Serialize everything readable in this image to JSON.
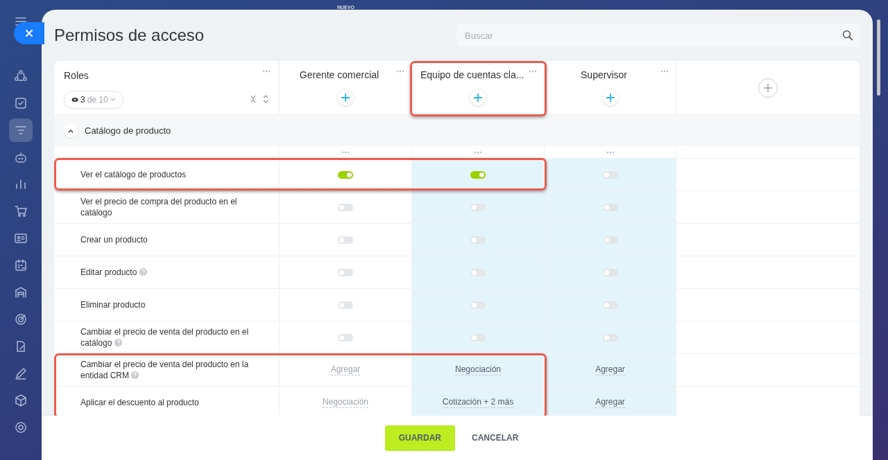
{
  "top_label": "NUEVO",
  "sidebar": {
    "items": [
      {
        "selected": false
      },
      {
        "selected": false
      },
      {
        "selected": true
      },
      {
        "selected": false
      },
      {
        "selected": false
      },
      {
        "selected": false
      },
      {
        "selected": false
      },
      {
        "selected": false
      },
      {
        "selected": false
      },
      {
        "selected": false
      },
      {
        "selected": false
      },
      {
        "selected": false
      },
      {
        "selected": false
      },
      {
        "selected": false
      }
    ]
  },
  "title": "Permisos de acceso",
  "search": {
    "placeholder": "Buscar"
  },
  "roles_header": {
    "label": "Roles",
    "visible_count": "3",
    "total": "de 10"
  },
  "columns": [
    {
      "name": "Gerente comercial",
      "highlighted": false,
      "tinted": false
    },
    {
      "name": "Equipo de cuentas cla...",
      "highlighted": true,
      "tinted": true
    },
    {
      "name": "Supervisor",
      "highlighted": false,
      "tinted": true
    }
  ],
  "section": {
    "title": "Catálogo de producto",
    "expanded": true
  },
  "rows": [
    {
      "label": "Ver el catálogo de productos",
      "help": false,
      "highlighted": true,
      "cells": [
        {
          "kind": "toggle",
          "on": true
        },
        {
          "kind": "toggle",
          "on": true
        },
        {
          "kind": "toggle",
          "on": false
        }
      ]
    },
    {
      "label": "Ver el precio de compra del producto en el catálogo",
      "help": false,
      "highlighted": false,
      "cells": [
        {
          "kind": "toggle",
          "on": false
        },
        {
          "kind": "toggle",
          "on": false
        },
        {
          "kind": "toggle",
          "on": false
        }
      ]
    },
    {
      "label": "Crear un producto",
      "help": false,
      "highlighted": false,
      "cells": [
        {
          "kind": "toggle",
          "on": false
        },
        {
          "kind": "toggle",
          "on": false
        },
        {
          "kind": "toggle",
          "on": false
        }
      ]
    },
    {
      "label": "Editar producto",
      "help": true,
      "highlighted": false,
      "cells": [
        {
          "kind": "toggle",
          "on": false
        },
        {
          "kind": "toggle",
          "on": false
        },
        {
          "kind": "toggle",
          "on": false
        }
      ]
    },
    {
      "label": "Eliminar producto",
      "help": false,
      "highlighted": false,
      "cells": [
        {
          "kind": "toggle",
          "on": false
        },
        {
          "kind": "toggle",
          "on": false
        },
        {
          "kind": "toggle",
          "on": false
        }
      ]
    },
    {
      "label": "Cambiar el precio de venta del producto en el catálogo",
      "help": true,
      "highlighted": false,
      "cells": [
        {
          "kind": "toggle",
          "on": false
        },
        {
          "kind": "toggle",
          "on": false
        },
        {
          "kind": "toggle",
          "on": false
        }
      ]
    },
    {
      "label": "Cambiar el precio de venta del producto en la entidad CRM",
      "help": true,
      "highlighted": true,
      "cells": [
        {
          "kind": "select",
          "value": "Agregar",
          "muted": true
        },
        {
          "kind": "select",
          "value": "Negociación",
          "muted": false
        },
        {
          "kind": "select",
          "value": "Agregar",
          "muted": false
        }
      ]
    },
    {
      "label": "Aplicar el descuento al producto",
      "help": false,
      "highlighted": true,
      "cells": [
        {
          "kind": "select",
          "value": "Negociación",
          "muted": true
        },
        {
          "kind": "select",
          "value": "Cotización + 2 más",
          "muted": false
        },
        {
          "kind": "select",
          "value": "Agregar",
          "muted": false
        }
      ]
    }
  ],
  "buttons": [
    {
      "label": "GUARDAR",
      "kind": "primary"
    },
    {
      "label": "CANCELAR",
      "kind": "link"
    }
  ]
}
